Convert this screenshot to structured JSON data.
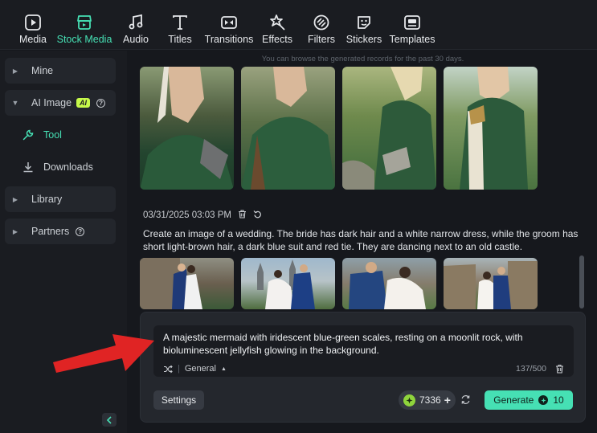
{
  "toolbar": {
    "items": [
      {
        "label": "Media",
        "icon": "media-icon"
      },
      {
        "label": "Stock Media",
        "icon": "stock-media-icon",
        "active": true
      },
      {
        "label": "Audio",
        "icon": "audio-icon"
      },
      {
        "label": "Titles",
        "icon": "titles-icon"
      },
      {
        "label": "Transitions",
        "icon": "transitions-icon"
      },
      {
        "label": "Effects",
        "icon": "effects-icon"
      },
      {
        "label": "Filters",
        "icon": "filters-icon"
      },
      {
        "label": "Stickers",
        "icon": "stickers-icon"
      },
      {
        "label": "Templates",
        "icon": "templates-icon"
      }
    ]
  },
  "sidebar": {
    "mine": "Mine",
    "ai_image": "AI Image",
    "ai_badge": "AI",
    "tool": "Tool",
    "downloads": "Downloads",
    "library": "Library",
    "partners": "Partners"
  },
  "main": {
    "notice": "You can browse the generated records for the past 30 days.",
    "record": {
      "timestamp": "03/31/2025 03:03 PM",
      "prompt": "Create an image of a wedding. The bride has dark hair and a white narrow dress, while the groom has short light-brown hair, a dark blue suit and red tie. They are dancing next to an old castle."
    }
  },
  "generator": {
    "input_text": "A majestic mermaid with iridescent blue-green scales, resting on a moonlit rock, with bioluminescent jellyfish glowing in the background.",
    "style": "General",
    "char_count": "137/500",
    "settings_label": "Settings",
    "credits": "7336",
    "generate_label": "Generate",
    "generate_cost": "10"
  },
  "colors": {
    "accent": "#46e0b4",
    "background": "#16181d",
    "panel": "#24272d",
    "arrow": "#e02424"
  }
}
